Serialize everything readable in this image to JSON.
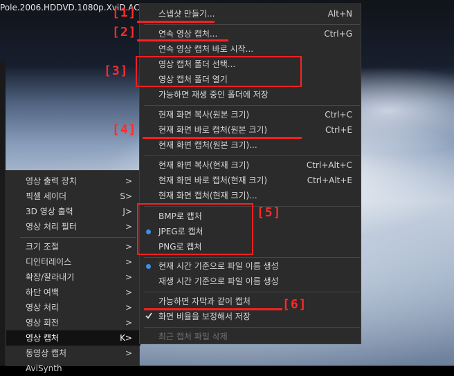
{
  "window": {
    "title": "Pole.2006.HDDVD.1080p.XviD.AC3-"
  },
  "parent_menu": {
    "items": [
      {
        "label": "영상 출력 장치",
        "shortcut": ">"
      },
      {
        "label": "픽셀 세이더",
        "shortcut": "S>"
      },
      {
        "label": "3D 영상 출력",
        "shortcut": "J>"
      },
      {
        "label": "영상 처리 필터",
        "shortcut": ">"
      },
      {
        "label": "크기 조절",
        "shortcut": ">"
      },
      {
        "label": "디인터레이스",
        "shortcut": ">"
      },
      {
        "label": "확장/잘라내기",
        "shortcut": ">"
      },
      {
        "label": "하단 여백",
        "shortcut": ">"
      },
      {
        "label": "영상 처리",
        "shortcut": ">"
      },
      {
        "label": "영상 회전",
        "shortcut": ">"
      },
      {
        "label": "영상 캡처",
        "shortcut": "K>"
      },
      {
        "label": "동영상 캡처",
        "shortcut": ">"
      },
      {
        "label": "AviSynth",
        "shortcut": ""
      }
    ]
  },
  "submenu": {
    "items": [
      {
        "label": "스냅샷 만들기...",
        "shortcut": "Alt+N"
      },
      {
        "label": "연속 영상 캡처...",
        "shortcut": "Ctrl+G"
      },
      {
        "label": "연속 영상 캡처 바로 시작...",
        "shortcut": ""
      },
      {
        "label": "영상 캡처 폴더 선택...",
        "shortcut": ""
      },
      {
        "label": "영상 캡처 폴더 열기",
        "shortcut": ""
      },
      {
        "label": "가능하면 재생 중인 폴더에 저장",
        "shortcut": ""
      },
      {
        "label": "현재 화면 복사(원본 크기)",
        "shortcut": "Ctrl+C"
      },
      {
        "label": "현재 화면 바로 캡처(원본 크기)",
        "shortcut": "Ctrl+E"
      },
      {
        "label": "현재 화면 캡처(원본 크기)...",
        "shortcut": ""
      },
      {
        "label": "현재 화면 복사(현재 크기)",
        "shortcut": "Ctrl+Alt+C"
      },
      {
        "label": "현재 화면 바로 캡처(현재 크기)",
        "shortcut": "Ctrl+Alt+E"
      },
      {
        "label": "현재 화면 캡처(현재 크기)...",
        "shortcut": ""
      },
      {
        "label": "BMP로 캡처",
        "shortcut": ""
      },
      {
        "label": "JPEG로 캡처",
        "shortcut": ""
      },
      {
        "label": "PNG로 캡처",
        "shortcut": ""
      },
      {
        "label": "현재 시간 기준으로 파일 이름 생성",
        "shortcut": ""
      },
      {
        "label": "재생 시간 기준으로 파일 이름 생성",
        "shortcut": ""
      },
      {
        "label": "가능하면 자막과 같이 캡처",
        "shortcut": ""
      },
      {
        "label": "화면 비율을 보정해서 저장",
        "shortcut": ""
      },
      {
        "label": "최근 캡처 파일 삭제",
        "shortcut": ""
      }
    ]
  },
  "annotations": [
    "[1]",
    "[2]",
    "[3]",
    "[4]",
    "[5]",
    "[6]"
  ],
  "colors": {
    "annotation": "#ff2020",
    "radio": "#3f8ee8",
    "menu_bg": "#2b2b2b"
  }
}
